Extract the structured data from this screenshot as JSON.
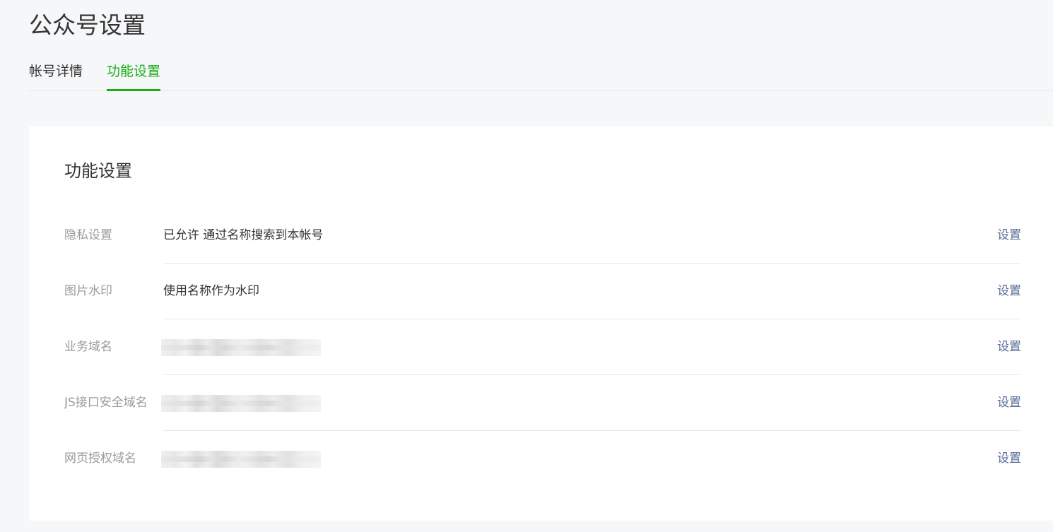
{
  "page": {
    "title": "公众号设置"
  },
  "tabs": [
    {
      "label": "帐号详情",
      "active": false
    },
    {
      "label": "功能设置",
      "active": true
    }
  ],
  "card": {
    "title": "功能设置",
    "rows": [
      {
        "label": "隐私设置",
        "value": "已允许 通过名称搜索到本帐号",
        "action": "设置"
      },
      {
        "label": "图片水印",
        "value": "使用名称作为水印",
        "action": "设置"
      },
      {
        "label": "业务域名",
        "value": "",
        "action": "设置"
      },
      {
        "label": "JS接口安全域名",
        "value": "",
        "action": "设置"
      },
      {
        "label": "网页授权域名",
        "value": "",
        "action": "设置"
      }
    ]
  },
  "colors": {
    "accent_green": "#1aad19",
    "link_blue": "#576b95",
    "background": "#f6f7f9"
  }
}
